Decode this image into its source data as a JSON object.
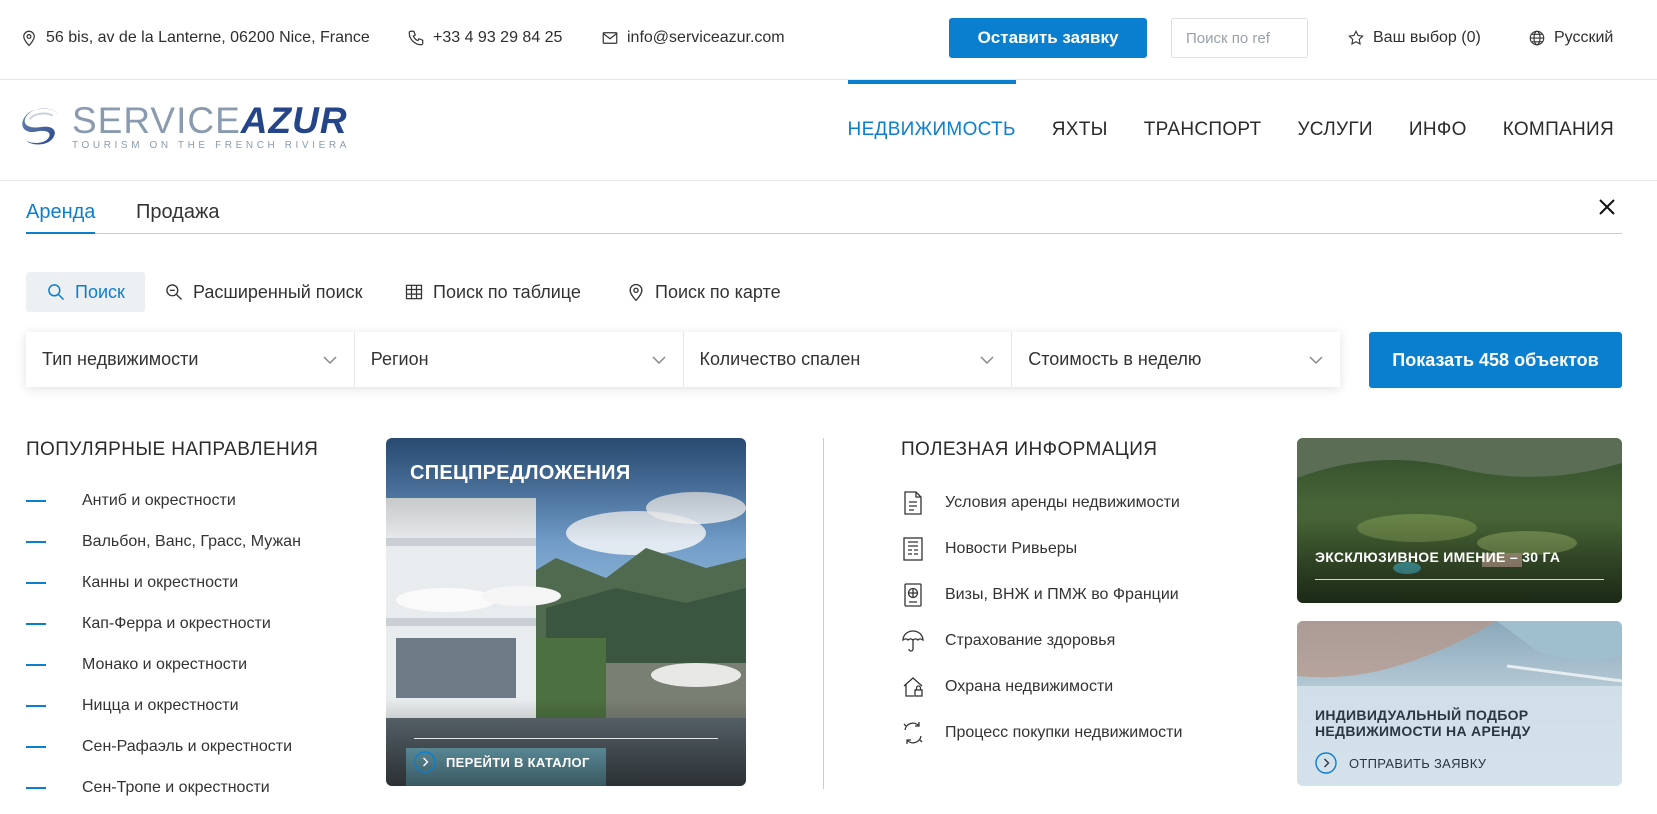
{
  "topbar": {
    "address": "56 bis, av de la Lanterne, 06200 Nice, France",
    "phone": "+33 4 93 29 84 25",
    "email": "info@serviceazur.com",
    "request_button": "Оставить заявку",
    "ref_search_placeholder": "Поиск по ref",
    "favorites": "Ваш выбор (0)",
    "language": "Русский"
  },
  "logo": {
    "service": "SERVICE",
    "azur": "AZUR",
    "tagline": "TOURISM ON THE FRENCH RIVIERA"
  },
  "nav": {
    "items": [
      {
        "label": "НЕДВИЖИМОСТЬ",
        "active": true
      },
      {
        "label": "ЯХТЫ",
        "active": false
      },
      {
        "label": "ТРАНСПОРТ",
        "active": false
      },
      {
        "label": "УСЛУГИ",
        "active": false
      },
      {
        "label": "ИНФО",
        "active": false
      },
      {
        "label": "КОМПАНИЯ",
        "active": false
      }
    ]
  },
  "mode_tabs": {
    "rent": "Аренда",
    "sale": "Продажа",
    "active": "rent"
  },
  "search_types": {
    "basic": "Поиск",
    "advanced": "Расширенный поиск",
    "table": "Поиск по таблице",
    "map": "Поиск по карте"
  },
  "filters": {
    "property_type": "Тип недвижимости",
    "region": "Регион",
    "bedrooms": "Количество спален",
    "price_week": "Стоимость в неделю",
    "show_button": "Показать 458 объектов"
  },
  "popular": {
    "title": "ПОПУЛЯРНЫЕ НАПРАВЛЕНИЯ",
    "items": [
      "Антиб и окрестности",
      "Вальбон, Ванс, Грасс, Мужан",
      "Канны и окрестности",
      "Кап-Ферра и окрестности",
      "Монако и окрестности",
      "Ницца и окрестности",
      "Сен-Рафаэль и окрестности",
      "Сен-Тропе и окрестности"
    ]
  },
  "special_offers": {
    "title": "СПЕЦПРЕДЛОЖЕНИЯ",
    "link": "ПЕРЕЙТИ В КАТАЛОГ"
  },
  "useful_info": {
    "title": "ПОЛЕЗНАЯ ИНФОРМАЦИЯ",
    "items": [
      {
        "label": "Условия аренды недвижимости",
        "icon": "document-icon"
      },
      {
        "label": "Новости Ривьеры",
        "icon": "news-icon"
      },
      {
        "label": "Визы, ВНЖ и ПМЖ во Франции",
        "icon": "passport-icon"
      },
      {
        "label": "Страхование здоровья",
        "icon": "umbrella-icon"
      },
      {
        "label": "Охрана недвижимости",
        "icon": "house-lock-icon"
      },
      {
        "label": "Процесс покупки недвижимости",
        "icon": "process-icon"
      }
    ]
  },
  "promos": {
    "estate_title": "ЭКСКЛЮЗИВНОЕ ИМЕНИЕ – 30 ГА",
    "selection_title": "ИНДИВИДУАЛЬНЫЙ ПОДБОР НЕДВИЖИМОСТИ НА АРЕНДУ",
    "selection_link": "ОТПРАВИТЬ ЗАЯВКУ"
  },
  "colors": {
    "accent": "#0a7fd0",
    "text": "#2b2b2b",
    "logo_dark": "#25458a",
    "logo_light": "#8a9bb0"
  }
}
